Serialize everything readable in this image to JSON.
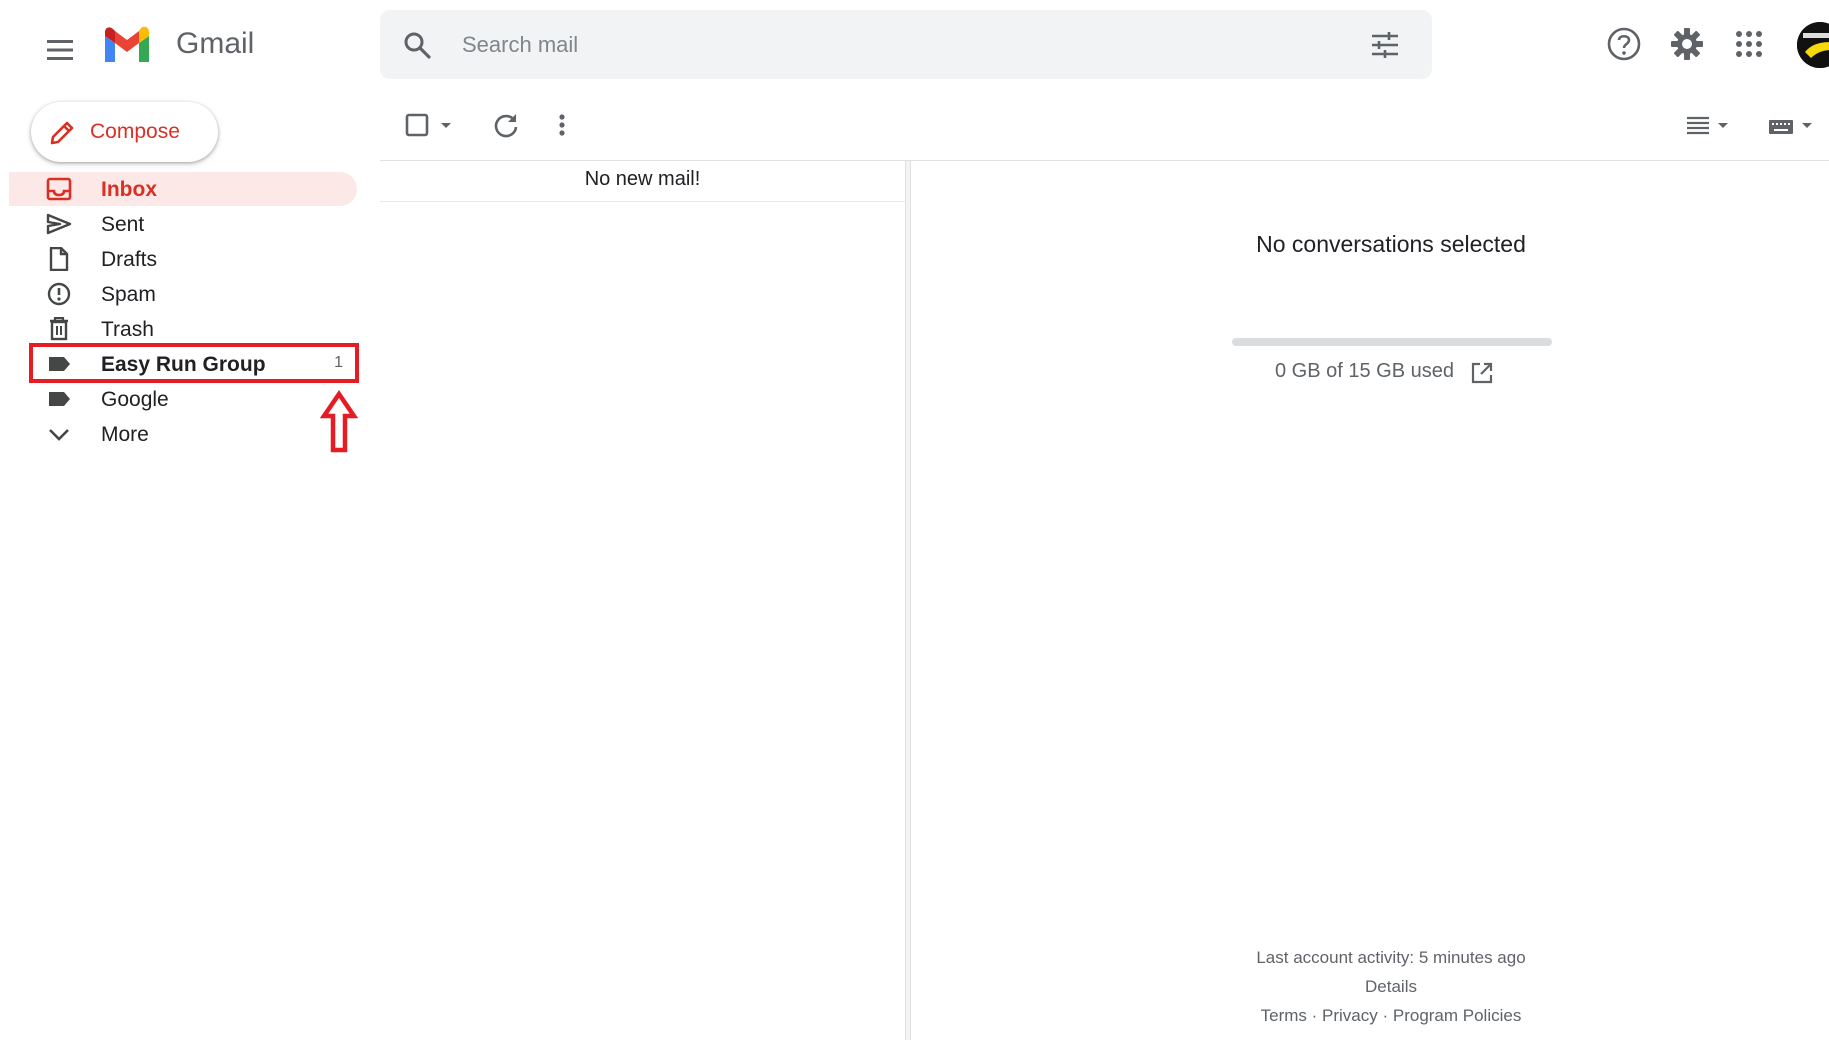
{
  "header": {
    "brand": "Gmail",
    "search_placeholder": "Search mail"
  },
  "compose": {
    "label": "Compose"
  },
  "sidebar": {
    "items": [
      {
        "label": "Inbox",
        "icon": "inbox-icon",
        "active": true
      },
      {
        "label": "Sent",
        "icon": "send-icon"
      },
      {
        "label": "Drafts",
        "icon": "draft-icon"
      },
      {
        "label": "Spam",
        "icon": "spam-icon"
      },
      {
        "label": "Trash",
        "icon": "trash-icon"
      },
      {
        "label": "Easy Run Group",
        "icon": "label-icon",
        "count": "1",
        "highlighted": true
      },
      {
        "label": "Google",
        "icon": "label-icon"
      },
      {
        "label": "More",
        "icon": "chevron-down-icon"
      }
    ]
  },
  "list": {
    "empty_text": "No new mail!"
  },
  "reading_pane": {
    "empty_text": "No conversations selected",
    "storage_text": "0 GB of 15 GB used",
    "storage_used_fraction": 0,
    "activity": "Last account activity: 5 minutes ago",
    "details": "Details",
    "footer": {
      "terms": "Terms",
      "sep1": " · ",
      "privacy": "Privacy",
      "sep2": " · ",
      "policies": "Program Policies"
    }
  },
  "colors": {
    "accent": "#d93025",
    "annotation": "#e51c23",
    "inbox_bg": "#fce8e6",
    "search_bg": "#f1f3f4"
  }
}
